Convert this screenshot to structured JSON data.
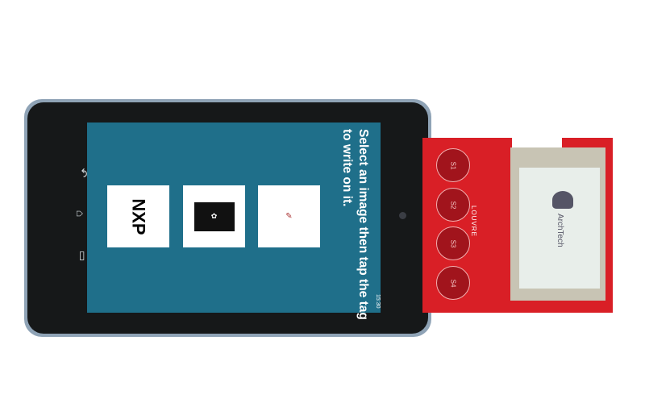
{
  "screen": {
    "message_line1": "Select an image then tap the tag",
    "message_line2": "to write on it.",
    "status_time": "15:30",
    "images": [
      {
        "label": "NXP"
      },
      {
        "label": "logo"
      },
      {
        "label": "drawing"
      }
    ]
  },
  "navbar": {
    "icons": [
      "back-icon",
      "home-icon",
      "recent-apps-icon"
    ]
  },
  "board": {
    "buttons": [
      "S1",
      "S2",
      "S3",
      "S4"
    ],
    "brand": "LOUVRE",
    "display_text": "ArchTech"
  },
  "colors": {
    "screen_bg": "#1f6f8a",
    "board": "#d91f26"
  }
}
